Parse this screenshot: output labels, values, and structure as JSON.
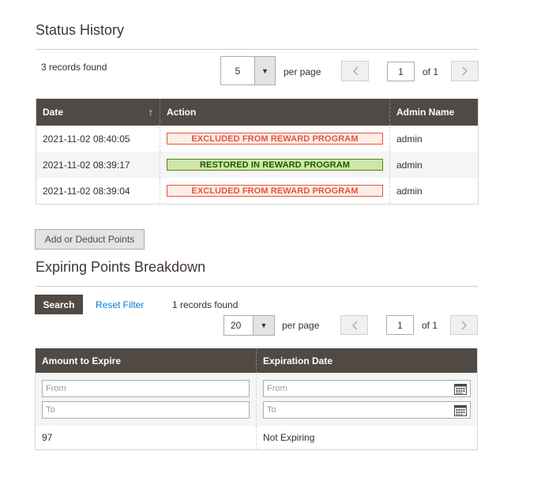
{
  "status_history": {
    "title": "Status History",
    "records_found": "3 records found",
    "per_page_value": "5",
    "per_page_label": "per page",
    "page_value": "1",
    "of_label": "of 1",
    "columns": [
      "Date",
      "Action",
      "Admin Name"
    ],
    "sort_indicator": "↑",
    "rows": [
      {
        "date": "2021-11-02 08:40:05",
        "action": "EXCLUDED FROM REWARD PROGRAM",
        "status": "excluded",
        "admin": "admin"
      },
      {
        "date": "2021-11-02 08:39:17",
        "action": "RESTORED IN REWARD PROGRAM",
        "status": "restored",
        "admin": "admin"
      },
      {
        "date": "2021-11-02 08:39:04",
        "action": "EXCLUDED FROM REWARD PROGRAM",
        "status": "excluded",
        "admin": "admin"
      }
    ]
  },
  "add_deduct_button": "Add or Deduct Points",
  "expiring_points": {
    "title": "Expiring Points Breakdown",
    "search_button": "Search",
    "reset_filter": "Reset Filter",
    "records_found": "1 records found",
    "per_page_value": "20",
    "per_page_label": "per page",
    "page_value": "1",
    "of_label": "of 1",
    "columns": [
      "Amount to Expire",
      "Expiration Date"
    ],
    "filters": {
      "amount_from": "From",
      "amount_to": "To",
      "date_from": "From",
      "date_to": "To"
    },
    "rows": [
      {
        "amount": "97",
        "expiration": "Not Expiring"
      }
    ]
  },
  "icons": {
    "prev": "chevron-left-icon",
    "next": "chevron-right-icon",
    "dropdown": "triangle-down-icon",
    "calendar": "calendar-icon"
  },
  "colors": {
    "header_bg": "#514943",
    "link": "#007bdb",
    "excluded": "#e5543d",
    "restored": "#185b00"
  }
}
